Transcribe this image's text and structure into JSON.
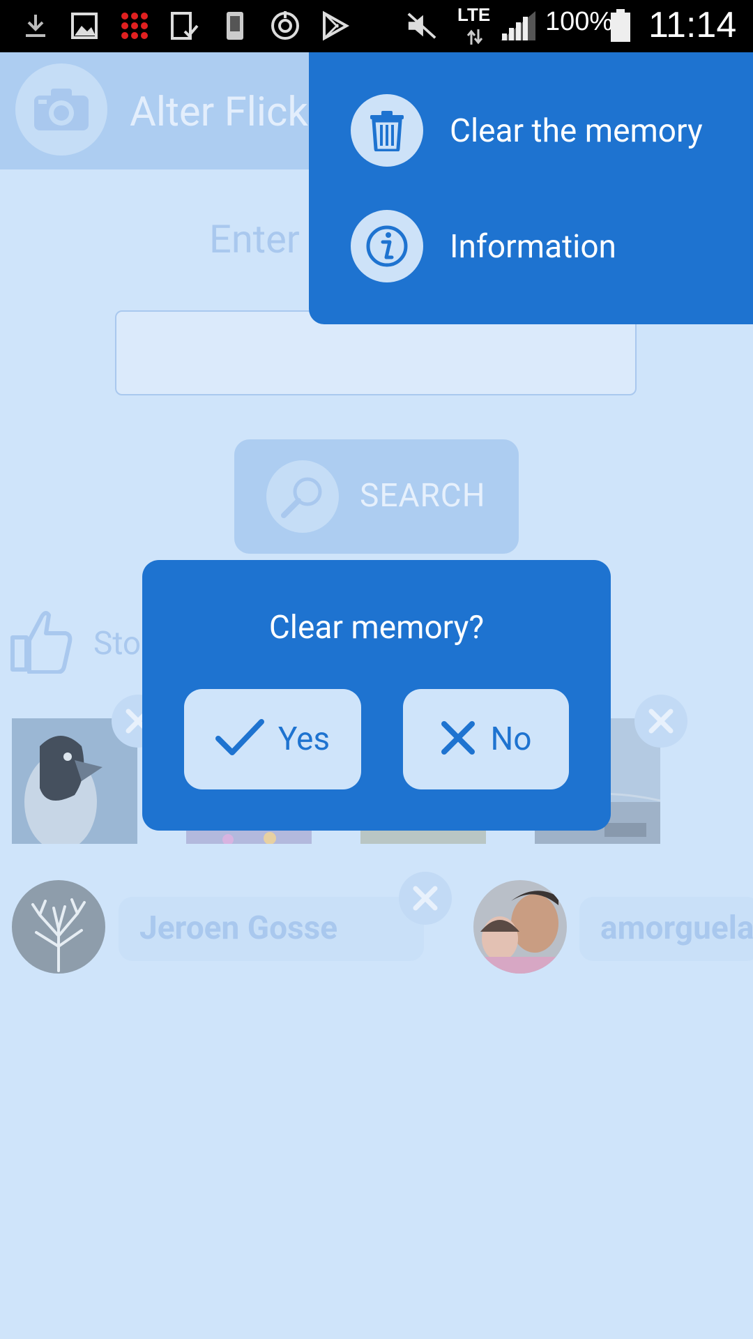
{
  "status_bar": {
    "battery_percent": "100%",
    "network": "LTE",
    "time": "11:14"
  },
  "header": {
    "app_title": "Alter Flick"
  },
  "main": {
    "enter_label": "Enter",
    "search_placeholder": "",
    "search_button_label": "SEARCH",
    "stored_label": "Sto"
  },
  "users": [
    {
      "name": "Jeroen Gosse"
    },
    {
      "name": "amorguela"
    }
  ],
  "overflow_menu": {
    "items": [
      {
        "label": "Clear the memory",
        "icon": "trash-icon"
      },
      {
        "label": "Information",
        "icon": "info-icon"
      }
    ]
  },
  "dialog": {
    "title": "Clear memory?",
    "yes_label": "Yes",
    "no_label": "No"
  },
  "colors": {
    "accent": "#1e73d0",
    "background": "#cfe4fa"
  }
}
